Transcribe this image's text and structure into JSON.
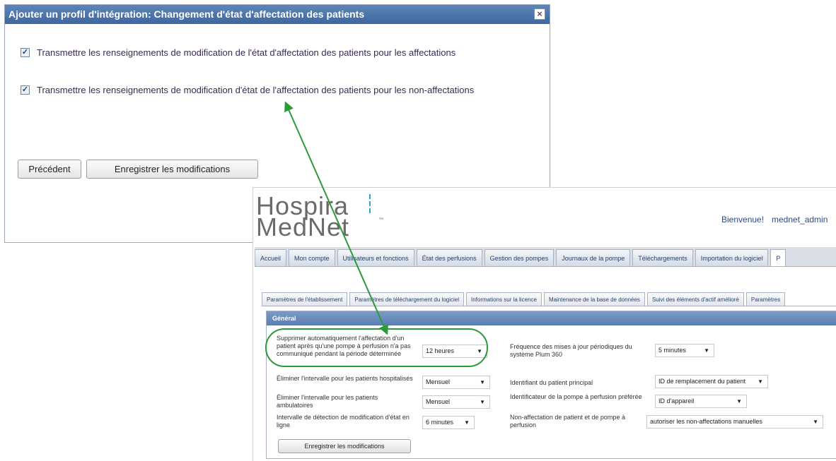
{
  "dialog": {
    "title": "Ajouter un profil d'intégration: Changement d'état d'affectation des patients",
    "close_symbol": "×",
    "checkbox_1": {
      "checked": true,
      "label": "Transmettre les renseignements de modification de l'état d'affectation des patients pour les affectations"
    },
    "checkbox_2": {
      "checked": true,
      "label": "Transmettre les renseignements de modification d'état de l'affectation des patients pour les non-affectations"
    },
    "previous_button": "Précédent",
    "save_button": "Enregistrer les modifications"
  },
  "mednet": {
    "logo_line1": "Hospira",
    "logo_line2": "MedNet",
    "logo_tm": "™",
    "welcome": "Bienvenue!",
    "username": "mednet_admin",
    "main_tabs": [
      "Accueil",
      "Mon compte",
      "Utilisateurs et fonctions",
      "État des perfusions",
      "Gestion des pompes",
      "Journaux de la pompe",
      "Téléchargements",
      "Importation du logiciel",
      "P"
    ],
    "sub_tabs": [
      "Paramètres de l'établissement",
      "Paramètres de téléchargement du logiciel",
      "Informations sur la licence",
      "Maintenance de la base de données",
      "Suivi des éléments d'actif amélioré",
      "Paramètres"
    ],
    "section_title": "Général",
    "left_fields": [
      {
        "label": "Supprimer automatiquement l'affectation d'un patient après qu'une pompe à perfusion n'a pas communiqué pendant la période déterminée",
        "value": "12 heures"
      },
      {
        "label": "Éliminer l'intervalle pour les patients hospitalisés",
        "value": "Mensuel"
      },
      {
        "label": "Éliminer l'intervalle pour les patients ambulatoires",
        "value": "Mensuel"
      },
      {
        "label": "Intervalle de détection de modification d'état en ligne",
        "value": "6 minutes"
      }
    ],
    "right_fields": [
      {
        "label": "Fréquence des mises à jour périodiques du système Plum 360",
        "value": "5 minutes"
      },
      {
        "label": "Identifiant du patient principal",
        "value": "ID de remplacement du patient"
      },
      {
        "label": "Identificateur de la pompe à perfusion préférée",
        "value": "ID d'appareil"
      },
      {
        "label": "Non-affectation de patient et de pompe à perfusion",
        "value": "autoriser les non-affectations manuelles"
      }
    ],
    "save_button": "Enregistrer les modifications"
  },
  "colors": {
    "arrow": "#2a9a3a",
    "highlight_ellipse": "#2a9a3a",
    "dialog_title_bg": "#4a72aa",
    "logo_accent": "#21a5de"
  },
  "icons": [
    "close-icon",
    "checkbox-icon",
    "chevron-down-icon",
    "double-arrow",
    "highlight-ellipse"
  ]
}
